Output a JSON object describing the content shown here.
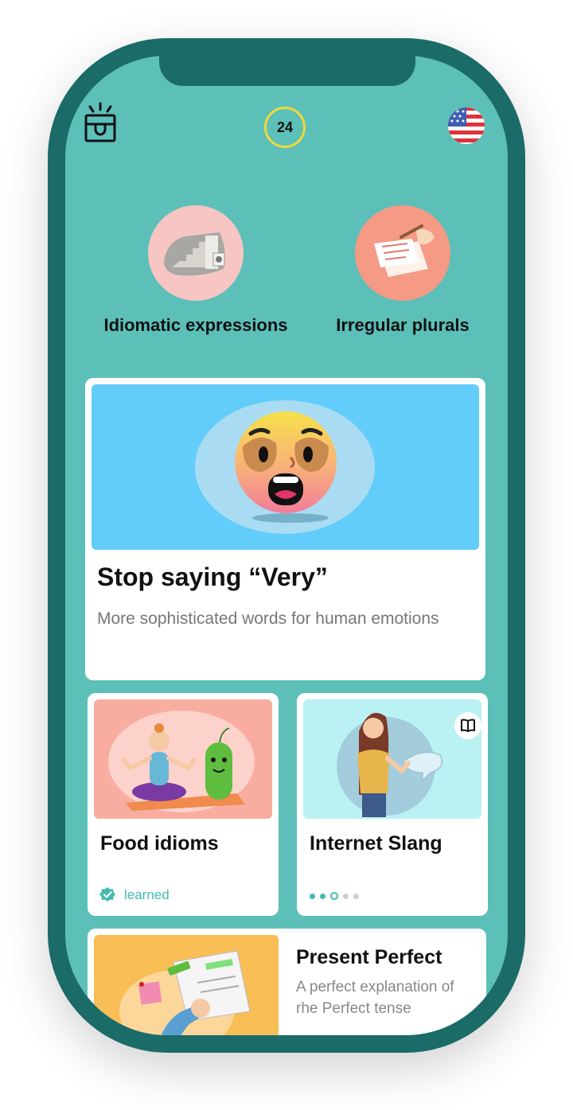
{
  "header": {
    "streak_count": "24"
  },
  "topics": [
    {
      "label": "Idiomatic expressions"
    },
    {
      "label": "Irregular plurals"
    }
  ],
  "featured": {
    "title": "Stop saying “Very”",
    "subtitle": "More sophisticated words for human emotions"
  },
  "cards": [
    {
      "title": "Food idioms",
      "status": "learned"
    },
    {
      "title": "Internet Slang",
      "progress": {
        "current": 3,
        "total": 5
      }
    }
  ],
  "present": {
    "title": "Present Perfect",
    "subtitle": "A perfect explanation of rhe Perfect tense"
  },
  "colors": {
    "phone_frame": "#1b6b68",
    "screen_bg": "#5cc0b9",
    "accent": "#3fbcae",
    "counter_ring": "#f1d83a"
  }
}
